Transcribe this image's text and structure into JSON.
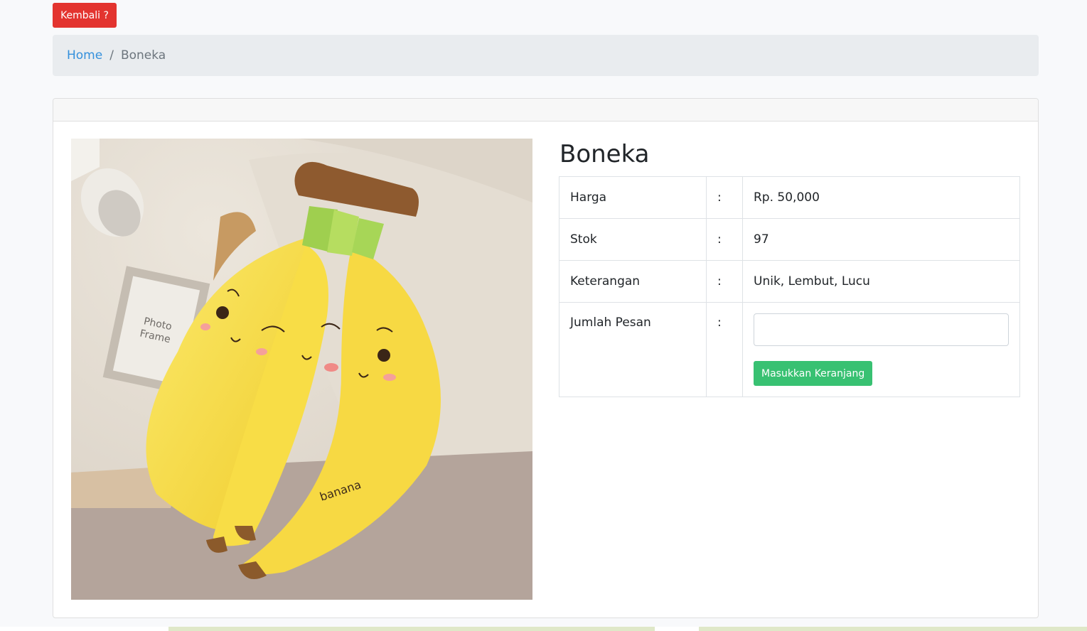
{
  "nav": {
    "back_label": "Kembali ?"
  },
  "breadcrumb": {
    "home": "Home",
    "separator": "/",
    "current": "Boneka"
  },
  "product": {
    "name": "Boneka",
    "image_text": "banana",
    "photo_frame_text_1": "Photo",
    "photo_frame_text_2": "Frame",
    "rows": [
      {
        "label": "Harga",
        "colon": ":",
        "value": "Rp. 50,000"
      },
      {
        "label": "Stok",
        "colon": ":",
        "value": "97"
      },
      {
        "label": "Keterangan",
        "colon": ":",
        "value": "Unik, Lembut, Lucu"
      }
    ],
    "order": {
      "label": "Jumlah Pesan",
      "colon": ":",
      "quantity_value": "",
      "button_label": "Masukkan Keranjang"
    }
  },
  "colors": {
    "danger": "#e3342f",
    "success": "#38c172",
    "link": "#3490dc"
  }
}
